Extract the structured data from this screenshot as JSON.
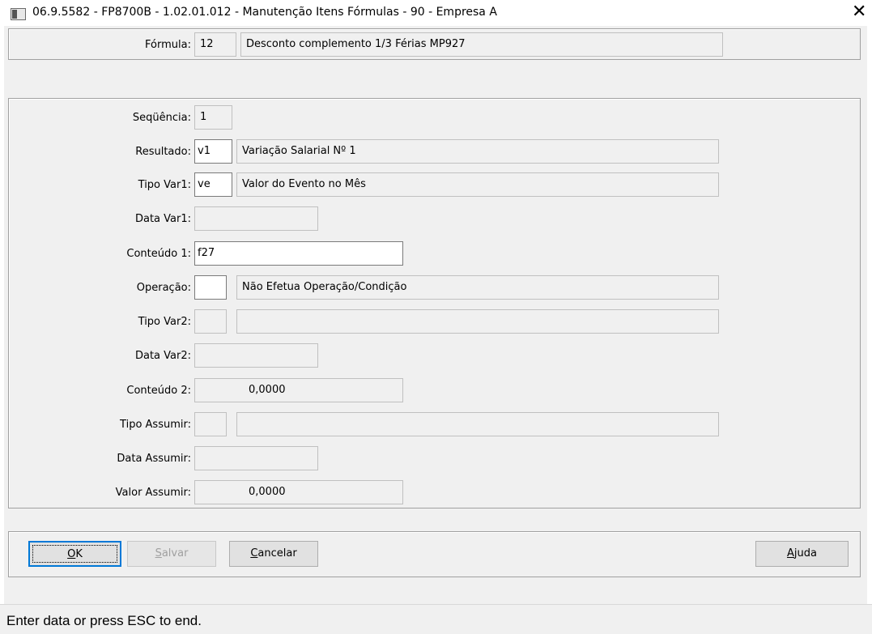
{
  "window": {
    "title": "06.9.5582 - FP8700B - 1.02.01.012 - Manutenção Itens Fórmulas - 90 - Empresa A",
    "icon": "window-app-icon",
    "close_glyph": "✕"
  },
  "formula": {
    "label": "Fórmula:",
    "code": "12",
    "description": "Desconto complemento 1/3 Férias MP927"
  },
  "fields": {
    "sequencia": {
      "label": "Seqüência:",
      "value": "1"
    },
    "resultado": {
      "label": "Resultado:",
      "value": "v1",
      "description": "Variação Salarial Nº 1"
    },
    "tipo_var1": {
      "label": "Tipo Var1:",
      "value": "ve",
      "description": "Valor do Evento no Mês"
    },
    "data_var1": {
      "label": "Data Var1:",
      "value": ""
    },
    "conteudo1": {
      "label": "Conteúdo 1:",
      "value": "f27"
    },
    "operacao": {
      "label": "Operação:",
      "value": "",
      "description": "Não Efetua Operação/Condição"
    },
    "tipo_var2": {
      "label": "Tipo Var2:",
      "value": "",
      "description": ""
    },
    "data_var2": {
      "label": "Data Var2:",
      "value": ""
    },
    "conteudo2": {
      "label": "Conteúdo 2:",
      "value": "0,0000"
    },
    "tipo_assumir": {
      "label": "Tipo Assumir:",
      "value": "",
      "description": ""
    },
    "data_assumir": {
      "label": "Data Assumir:",
      "value": ""
    },
    "valor_assumir": {
      "label": "Valor Assumir:",
      "value": "0,0000"
    }
  },
  "buttons": {
    "ok": {
      "accel": "O",
      "rest": "K"
    },
    "salvar": {
      "accel": "S",
      "rest": "alvar"
    },
    "cancelar": {
      "accel": "C",
      "rest": "ancelar"
    },
    "ajuda": {
      "accel": "A",
      "rest": "juda"
    }
  },
  "status": {
    "text": "Enter data or press ESC to end."
  },
  "colors": {
    "default_button_border": "#0078d7",
    "window_bg": "#f0f0f0"
  }
}
